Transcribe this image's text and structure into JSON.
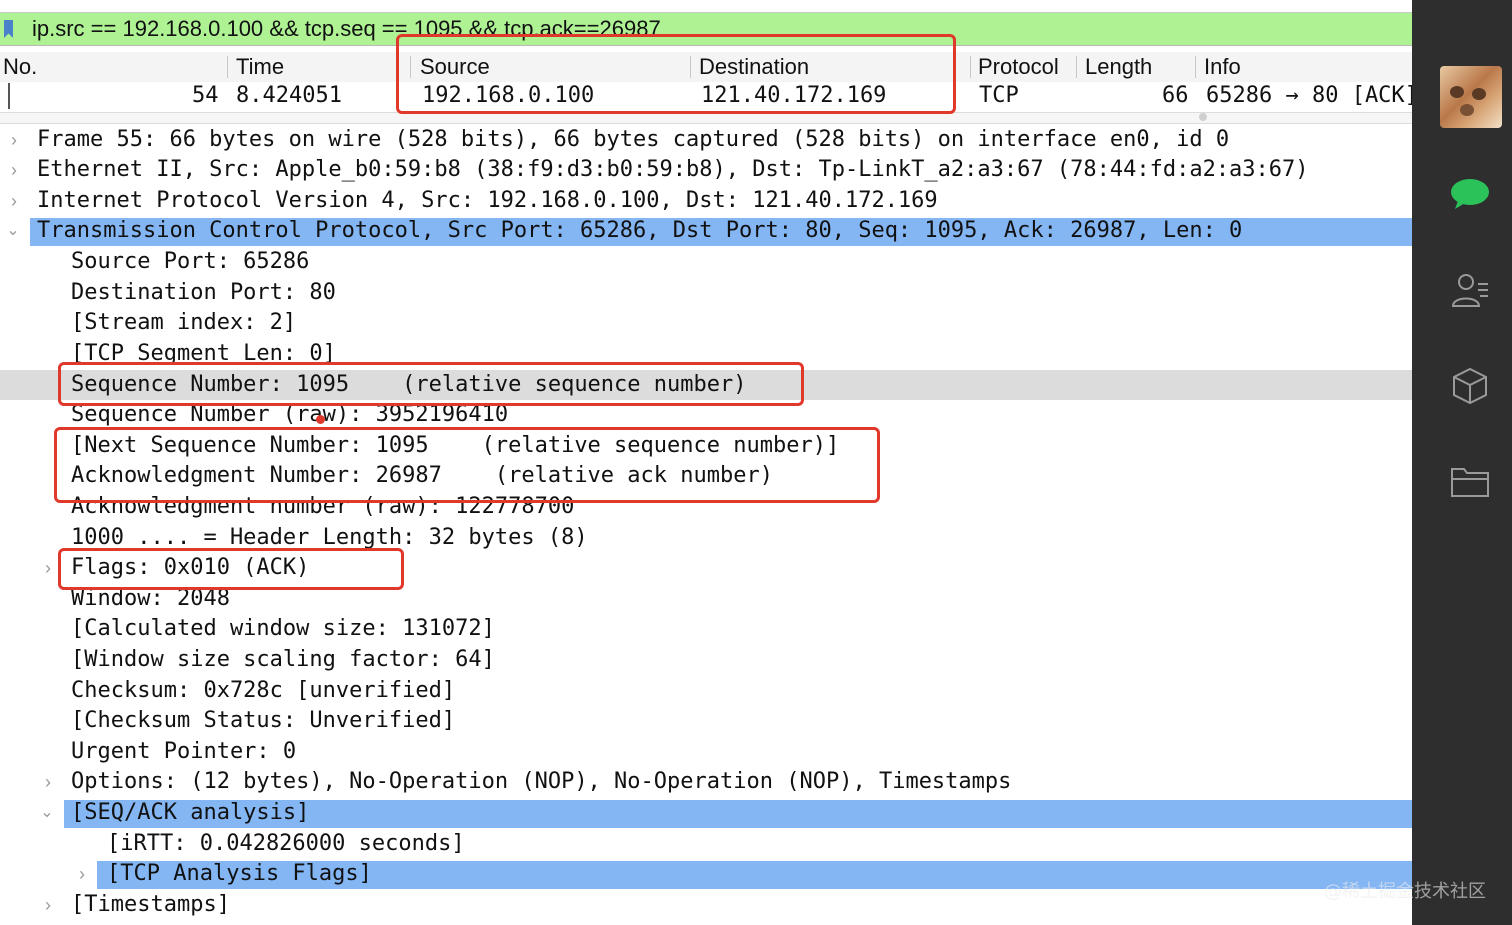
{
  "filter": {
    "expression": "ip.src == 192.168.0.100 && tcp.seq == 1095 && tcp.ack==26987"
  },
  "packet_list": {
    "columns": [
      "No.",
      "Time",
      "Source",
      "Destination",
      "Protocol",
      "Length",
      "Info"
    ],
    "row": {
      "no": "54",
      "time": "8.424051",
      "source": "192.168.0.100",
      "destination": "121.40.172.169",
      "protocol": "TCP",
      "length": "66",
      "info": "65286 → 80 [ACK]"
    }
  },
  "details": [
    "Frame 55: 66 bytes on wire (528 bits), 66 bytes captured (528 bits) on interface en0, id 0",
    "Ethernet II, Src: Apple_b0:59:b8 (38:f9:d3:b0:59:b8), Dst: Tp-LinkT_a2:a3:67 (78:44:fd:a2:a3:67)",
    "Internet Protocol Version 4, Src: 192.168.0.100, Dst: 121.40.172.169",
    "Transmission Control Protocol, Src Port: 65286, Dst Port: 80, Seq: 1095, Ack: 26987, Len: 0",
    "Source Port: 65286",
    "Destination Port: 80",
    "[Stream index: 2]",
    "[TCP Segment Len: 0]",
    "Sequence Number: 1095    (relative sequence number)",
    "Sequence Number (raw): 3952196410",
    "[Next Sequence Number: 1095    (relative sequence number)]",
    "Acknowledgment Number: 26987    (relative ack number)",
    "Acknowledgment number (raw): 122778700",
    "1000 .... = Header Length: 32 bytes (8)",
    "Flags: 0x010 (ACK)",
    "Window: 2048",
    "[Calculated window size: 131072]",
    "[Window size scaling factor: 64]",
    "Checksum: 0x728c [unverified]",
    "[Checksum Status: Unverified]",
    "Urgent Pointer: 0",
    "Options: (12 bytes), No-Operation (NOP), No-Operation (NOP), Timestamps",
    "[SEQ/ACK analysis]",
    "[iRTT: 0.042826000 seconds]",
    "[TCP Analysis Flags]",
    "[Timestamps]"
  ],
  "sidebar": {
    "icons": [
      "avatar",
      "chat-icon",
      "contacts-icon",
      "box-icon",
      "folder-icon"
    ]
  },
  "watermark": "@稀土掘金技术社区",
  "colors": {
    "filter_bg": "#aef294",
    "selection": "#84b6f4",
    "annotation": "#e0392b",
    "sidebar_bg": "#2e2e2e"
  }
}
